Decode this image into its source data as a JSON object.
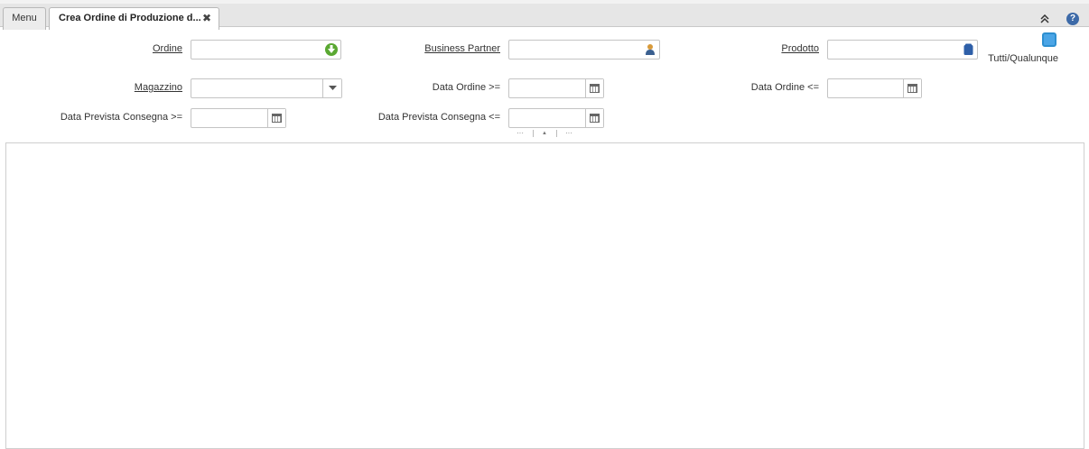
{
  "tabs": {
    "menu_label": "Menu",
    "active_label": "Crea Ordine di Produzione d...",
    "close_glyph": "✖"
  },
  "toolbar": {
    "collapse_glyph": "»",
    "help_glyph": "?"
  },
  "form": {
    "ordine_label": "Ordine",
    "ordine_value": "",
    "business_partner_label": "Business Partner",
    "business_partner_value": "",
    "prodotto_label": "Prodotto",
    "prodotto_value": "",
    "tutti_label": "Tutti/Qualunque",
    "magazzino_label": "Magazzino",
    "magazzino_value": "",
    "data_ordine_from_label": "Data Ordine >=",
    "data_ordine_from_value": "",
    "data_ordine_to_label": "Data Ordine <=",
    "data_ordine_to_value": "",
    "data_prevista_from_label": "Data Prevista Consegna >=",
    "data_prevista_from_value": "",
    "data_prevista_to_label": "Data Prevista Consegna <=",
    "data_prevista_to_value": ""
  },
  "splitter": {
    "left_glyph": "···",
    "up_glyph": "▲",
    "right_glyph": "···"
  },
  "colors": {
    "accent_blue": "#4ba5e6",
    "green_icon": "#5aa832",
    "partner_icon": "#d89a3a",
    "product_icon": "#2e5fa8"
  }
}
